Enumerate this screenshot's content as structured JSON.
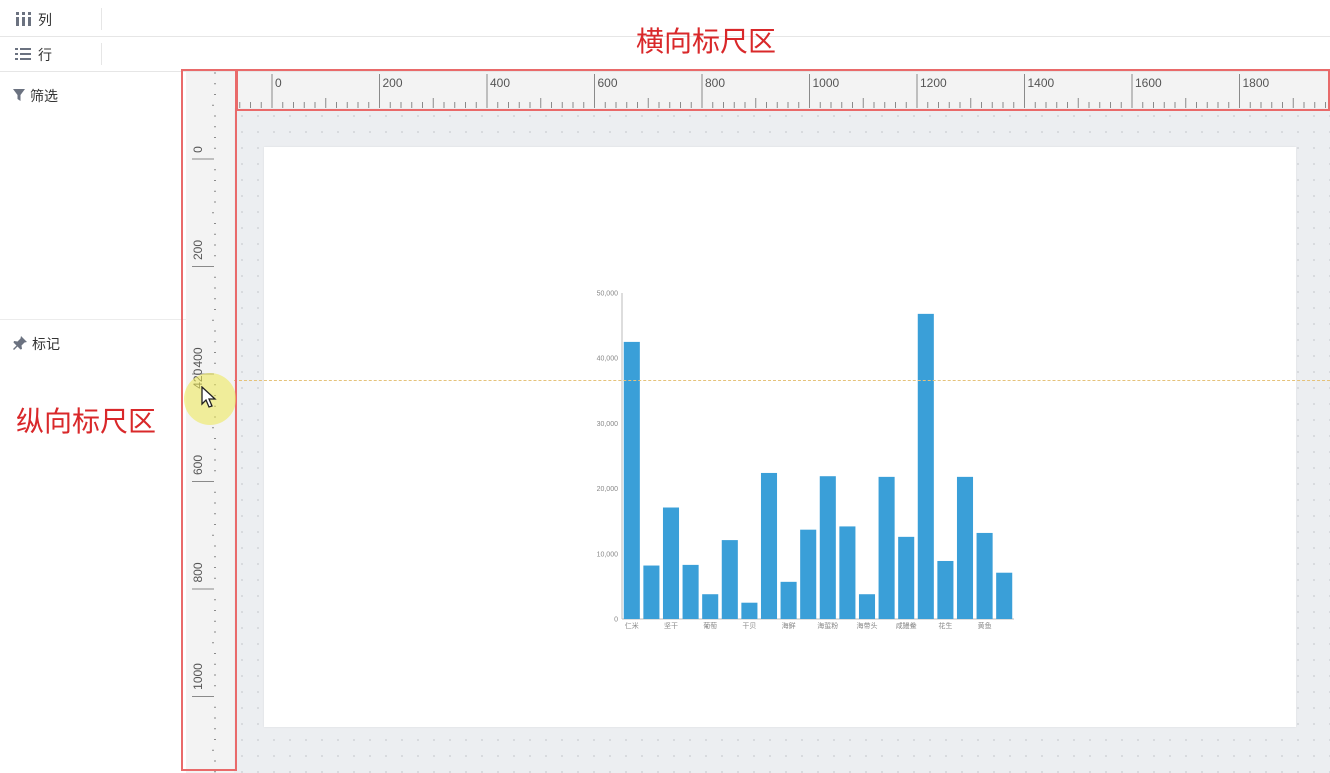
{
  "shelves": {
    "columns": {
      "icon": "columns-icon",
      "label": "列"
    },
    "rows": {
      "icon": "rows-icon",
      "label": "行"
    }
  },
  "panels": {
    "filter": {
      "icon": "filter-icon",
      "label": "筛选"
    },
    "marks": {
      "icon": "pin-icon",
      "label": "标记"
    }
  },
  "annotations": {
    "horizontal_ruler": "横向标尺区",
    "vertical_ruler": "纵向标尺区"
  },
  "ruler": {
    "h_labels": [
      "0",
      "200",
      "400",
      "600",
      "800",
      "1000",
      "1200",
      "1400",
      "1600",
      "1800"
    ],
    "v_labels": [
      "0",
      "200",
      "400",
      "600",
      "800",
      "1000"
    ],
    "cursor_readout": "420"
  },
  "colors": {
    "bar": "#3a9fd8",
    "highlight_box": "#e96a6a",
    "annotation": "#d9282a"
  },
  "chart_data": {
    "type": "bar",
    "categories": [
      "仁米",
      "",
      "坚干",
      "",
      "葡萄",
      "",
      "干贝",
      "",
      "海鲜",
      "",
      "海蜇粉",
      "",
      "海带头",
      "",
      "咸鳗鲞",
      "",
      "花生",
      "",
      "黄鱼",
      ""
    ],
    "values": [
      42500,
      8200,
      17100,
      8300,
      3800,
      12100,
      2500,
      22400,
      5700,
      13700,
      21900,
      14200,
      3800,
      21800,
      12600,
      46800,
      8900,
      21800,
      13200,
      7100
    ],
    "yticks": [
      "0",
      "10,000",
      "20,000",
      "30,000",
      "40,000",
      "50,000"
    ],
    "ylim": [
      0,
      50000
    ]
  }
}
